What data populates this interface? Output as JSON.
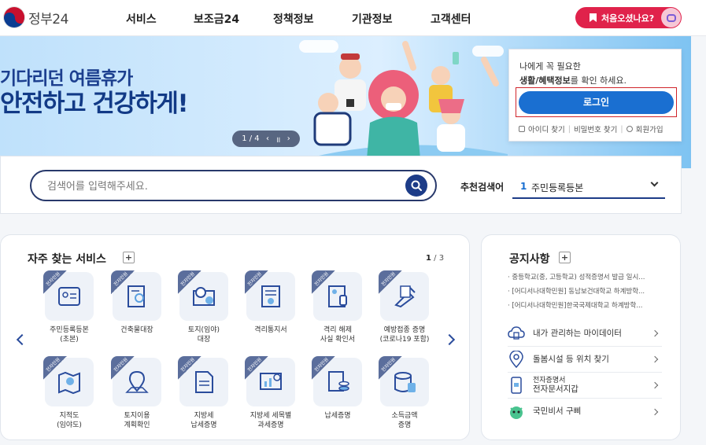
{
  "header": {
    "logo_text": "정부24",
    "nav": [
      "서비스",
      "보조금24",
      "정책정보",
      "기관정보",
      "고객센터"
    ],
    "first_visit_label": "처음오셨나요?"
  },
  "banner": {
    "line1": "기다리던 여름휴가",
    "line2": "안전하고 건강하게!",
    "pager_text": "1 / 4",
    "pager_prev": "‹",
    "pager_pause": "॥",
    "pager_next": "›"
  },
  "login": {
    "msg1": "나에게 꼭 필요한",
    "msg2_bold": "생활/혜택정보",
    "msg2_rest": "를 확인 하세요.",
    "button": "로그인",
    "find_id": "아이디 찾기",
    "find_pw": "비밀번호 찾기",
    "signup": "회원가입"
  },
  "search": {
    "placeholder": "검색어를 입력해주세요.",
    "recommend_label": "추천검색어",
    "recommend_rank": "1",
    "recommend_value": "주민등록등본"
  },
  "favorites": {
    "title": "자주 찾는 서비스",
    "plus": "+",
    "page_current": "1",
    "page_total": "/ 3",
    "badge": "전자민원",
    "items": [
      {
        "label": "주민등록등본\n(초본)",
        "icon": "id-card-icon"
      },
      {
        "label": "건축물대장",
        "icon": "building-doc-icon"
      },
      {
        "label": "토지(임야)\n대장",
        "icon": "land-map-icon"
      },
      {
        "label": "격리통지서",
        "icon": "quarantine-notice-icon"
      },
      {
        "label": "격리 해제\n사실 확인서",
        "icon": "release-certificate-icon"
      },
      {
        "label": "예방접종 증명\n(코로나19 포함)",
        "icon": "vaccine-icon"
      },
      {
        "label": "지적도\n(임야도)",
        "icon": "cadastral-map-icon"
      },
      {
        "label": "토지이용\n계획확인",
        "icon": "land-use-icon"
      },
      {
        "label": "지방세\n납세증명",
        "icon": "local-tax-icon"
      },
      {
        "label": "지방세 세목별\n과세증명",
        "icon": "tax-chart-icon"
      },
      {
        "label": "납세증명",
        "icon": "tax-payment-icon"
      },
      {
        "label": "소득금액\n증명",
        "icon": "income-icon"
      }
    ]
  },
  "notice": {
    "title": "공지사항",
    "plus": "+",
    "items": [
      "중등학교(중, 고등학교) 성적증명서 발급 일시...",
      "[어디서나대학민원] 동남보건대학교 하계방학...",
      "[어디서나대학민원]한국국제대학교 하계방학..."
    ],
    "links": [
      {
        "label": "내가 관리하는 마이데이터",
        "icon": "mydata-cloud-icon"
      },
      {
        "label": "돌봄시설 등 위치 찾기",
        "icon": "location-pin-icon"
      },
      {
        "label_small": "전자증명서",
        "label": "전자문서지갑",
        "icon": "wallet-phone-icon"
      },
      {
        "label": "국민비서 구삐",
        "icon": "gubbi-mascot-icon"
      }
    ]
  }
}
